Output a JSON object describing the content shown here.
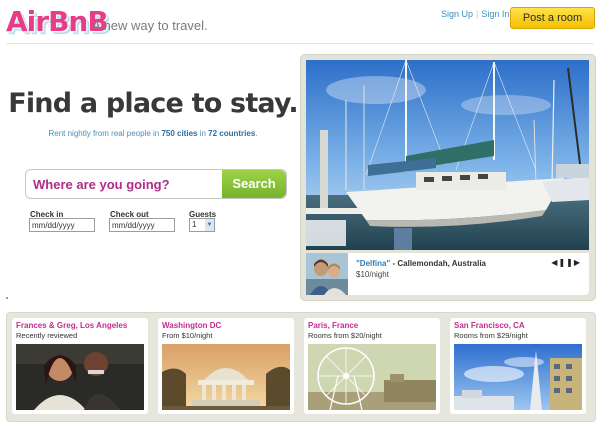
{
  "header": {
    "logo_text": "AirBnB",
    "tagline": "A new way to travel.",
    "signup_label": "Sign Up",
    "separator": "|",
    "signin_label": "Sign In",
    "post_room_label": "Post a room"
  },
  "hero": {
    "headline": "Find a place to stay.",
    "subline_prefix": "Rent nightly from real people in ",
    "cities_count": "750 cities",
    "subline_middle": " in ",
    "countries_count": "72 countries",
    "subline_suffix": ".",
    "search_placeholder": "Where are you going?",
    "search_button": "Search",
    "checkin_label": "Check in",
    "checkin_value": "mm/dd/yyyy",
    "checkout_label": "Check out",
    "checkout_value": "mm/dd/yyyy",
    "guests_label": "Guests",
    "guests_value": "1"
  },
  "featured": {
    "host_name": "\"Delfina\"",
    "location": " - Callemondah, Australia",
    "price": "$10/night",
    "controls": {
      "prev": "◀",
      "pause": "❚❚",
      "next": "▶"
    }
  },
  "cities": [
    {
      "title": "Frances & Greg, Los Angeles",
      "subtitle": "Recently reviewed"
    },
    {
      "title": "Washington DC",
      "subtitle": "From $10/night"
    },
    {
      "title": "Paris, France",
      "subtitle": "Rooms from $20/night"
    },
    {
      "title": "San Francisco, CA",
      "subtitle": "Rooms from $29/night"
    }
  ],
  "colors": {
    "brand_pink": "#e83d86",
    "link_blue": "#3a8fc0",
    "search_green": "#86c13a",
    "post_yellow": "#f5c000",
    "city_title": "#c22d8a"
  }
}
